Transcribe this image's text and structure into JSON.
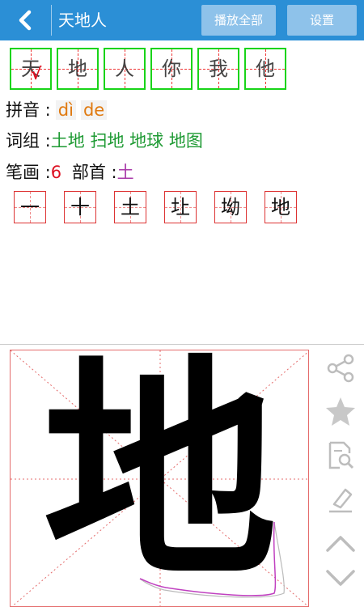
{
  "header": {
    "title": "天地人",
    "play_all": "播放全部",
    "settings": "设置"
  },
  "tiles": [
    "天",
    "地",
    "人",
    "你",
    "我",
    "他"
  ],
  "tile_check": "√",
  "pinyin": {
    "label": "拼音 :",
    "values": [
      "dì",
      "de"
    ]
  },
  "words": {
    "label": "词组 :",
    "values": [
      "土地",
      "扫地",
      "地球",
      "地图"
    ]
  },
  "strokes": {
    "label": "笔画 :",
    "count": "6",
    "radical_label": "部首 :",
    "radical": "土"
  },
  "stroke_steps": [
    "一",
    "十",
    "土",
    "圵",
    "坳",
    "地"
  ],
  "big_char": "地",
  "colors": {
    "header": "#2b8fd6",
    "tile_border": "#19d419",
    "grid_red": "#e46b6b",
    "pinyin": "#e07a10",
    "words": "#1e9a33",
    "radical": "#a93aa9"
  },
  "sidebar_icons": [
    "share-icon",
    "star-icon",
    "search-document-icon",
    "eraser-icon",
    "chevron-up-icon",
    "chevron-down-icon"
  ]
}
